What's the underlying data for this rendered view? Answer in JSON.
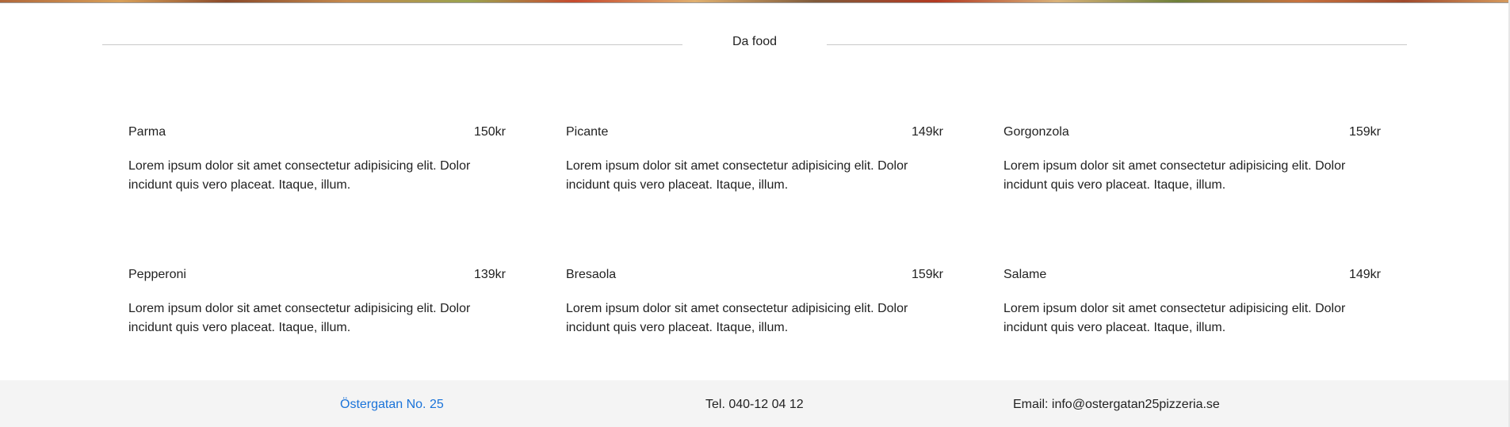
{
  "section": {
    "heading": "Da food"
  },
  "menu": {
    "items": [
      {
        "name": "Parma",
        "price": "150kr",
        "description": "Lorem ipsum dolor sit amet consectetur adipisicing elit. Dolor incidunt quis vero placeat. Itaque, illum."
      },
      {
        "name": "Picante",
        "price": "149kr",
        "description": "Lorem ipsum dolor sit amet consectetur adipisicing elit. Dolor incidunt quis vero placeat. Itaque, illum."
      },
      {
        "name": "Gorgonzola",
        "price": "159kr",
        "description": "Lorem ipsum dolor sit amet consectetur adipisicing elit. Dolor incidunt quis vero placeat. Itaque, illum."
      },
      {
        "name": "Pepperoni",
        "price": "139kr",
        "description": "Lorem ipsum dolor sit amet consectetur adipisicing elit. Dolor incidunt quis vero placeat. Itaque, illum."
      },
      {
        "name": "Bresaola",
        "price": "159kr",
        "description": "Lorem ipsum dolor sit amet consectetur adipisicing elit. Dolor incidunt quis vero placeat. Itaque, illum."
      },
      {
        "name": "Salame",
        "price": "149kr",
        "description": "Lorem ipsum dolor sit amet consectetur adipisicing elit. Dolor incidunt quis vero placeat. Itaque, illum."
      }
    ]
  },
  "footer": {
    "address": "Östergatan No. 25",
    "phone": "Tel. 040-12 04 12",
    "email": "Email: info@ostergatan25pizzeria.se"
  },
  "colors": {
    "link": "#1a73d9",
    "footer_bg": "#f4f4f4",
    "divider": "#c9c9c9"
  }
}
